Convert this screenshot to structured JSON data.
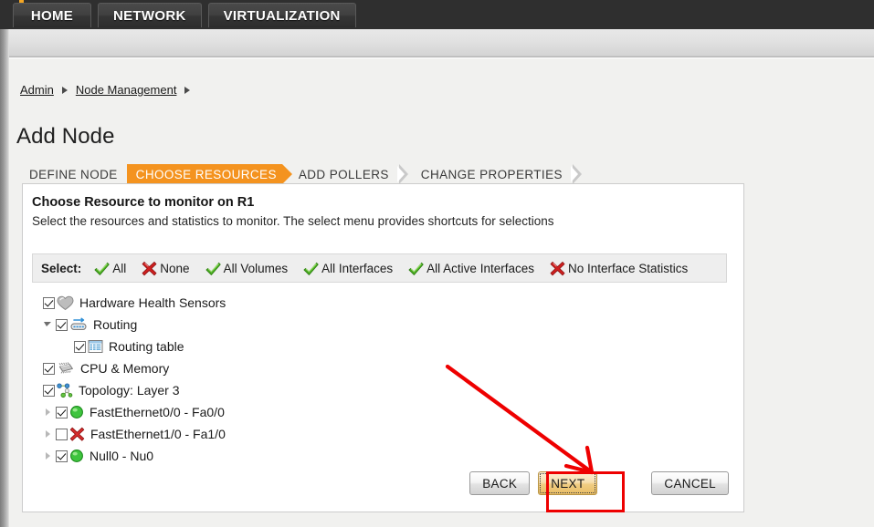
{
  "topnav": {
    "tabs": [
      {
        "label": "HOME"
      },
      {
        "label": "NETWORK"
      },
      {
        "label": "VIRTUALIZATION"
      }
    ]
  },
  "breadcrumb": {
    "items": [
      {
        "label": "Admin"
      },
      {
        "label": "Node Management"
      }
    ]
  },
  "page": {
    "title": "Add Node"
  },
  "wizard": {
    "steps": [
      {
        "label": "DEFINE NODE",
        "active": false
      },
      {
        "label": "CHOOSE RESOURCES",
        "active": true
      },
      {
        "label": "ADD POLLERS",
        "active": false
      },
      {
        "label": "CHANGE PROPERTIES",
        "active": false
      }
    ],
    "active_color": "#f4931f"
  },
  "panel": {
    "heading": "Choose Resource to monitor on R1",
    "subheading": "Select the resources and statistics to monitor. The select menu provides shortcuts for selections"
  },
  "selectbar": {
    "label": "Select:",
    "items": [
      {
        "label": "All",
        "icon": "green-check-icon"
      },
      {
        "label": "None",
        "icon": "red-x-icon"
      },
      {
        "label": "All Volumes",
        "icon": "green-check-icon"
      },
      {
        "label": "All Interfaces",
        "icon": "green-check-icon"
      },
      {
        "label": "All Active Interfaces",
        "icon": "green-check-icon"
      },
      {
        "label": "No Interface Statistics",
        "icon": "red-x-icon"
      }
    ]
  },
  "tree": {
    "rows": [
      {
        "label": "Hardware Health Sensors",
        "checked": true,
        "twisty": "none",
        "indent": 0,
        "icon": "heart-sensor-icon"
      },
      {
        "label": "Routing",
        "checked": true,
        "twisty": "expanded",
        "indent": 1,
        "icon": "router-icon"
      },
      {
        "label": "Routing table",
        "checked": true,
        "twisty": "none",
        "indent": 2,
        "icon": "table-grid-icon"
      },
      {
        "label": "CPU & Memory",
        "checked": true,
        "twisty": "none",
        "indent": 0,
        "icon": "cpu-chip-icon"
      },
      {
        "label": "Topology: Layer 3",
        "checked": true,
        "twisty": "none",
        "indent": 0,
        "icon": "topology-icon"
      },
      {
        "label": "FastEthernet0/0 - Fa0/0",
        "checked": true,
        "twisty": "collapsed",
        "indent": 1,
        "icon": "status-up-icon"
      },
      {
        "label": "FastEthernet1/0 - Fa1/0",
        "checked": false,
        "twisty": "collapsed",
        "indent": 1,
        "icon": "status-down-icon"
      },
      {
        "label": "Null0 - Nu0",
        "checked": true,
        "twisty": "collapsed",
        "indent": 1,
        "icon": "status-up-icon"
      }
    ]
  },
  "buttons": {
    "back": "BACK",
    "next": "NEXT",
    "cancel": "CANCEL"
  },
  "annotation": {
    "color": "#ee0000",
    "highlight_target": "next-button"
  },
  "colors": {
    "accent_orange": "#f4931f",
    "status_up_green": "#3cc43c",
    "status_down_red": "#d62b2b",
    "topnav_dark": "#2f2f2f"
  }
}
